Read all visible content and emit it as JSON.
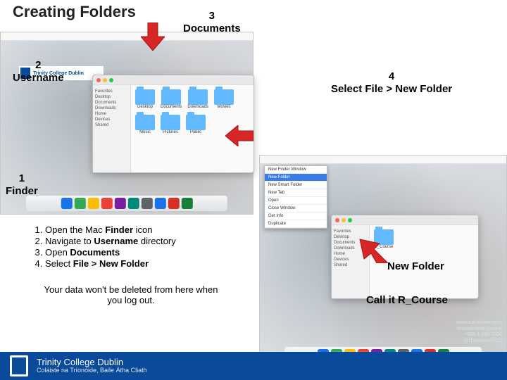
{
  "slide": {
    "title": "Creating Folders"
  },
  "callouts": {
    "c1": {
      "num": "1",
      "label": "Finder"
    },
    "c2": {
      "num": "2",
      "label": "Username"
    },
    "c3": {
      "num": "3",
      "label": "Documents"
    },
    "c4": {
      "num": "4",
      "label": "Select File > New Folder"
    },
    "c5": {
      "label": "New Folder"
    },
    "c6": {
      "label": "Call it R_Course"
    }
  },
  "steps": [
    {
      "pre": "Open the Mac ",
      "b": "Finder",
      "post": " icon"
    },
    {
      "pre": "Navigate to ",
      "b": "Username",
      "post": " directory"
    },
    {
      "pre": "Open ",
      "b": "Documents",
      "post": ""
    },
    {
      "pre": "Select ",
      "b": "File > New Folder",
      "post": ""
    }
  ],
  "note": "Your data won't be deleted from here when you log out.",
  "finder": {
    "sidebar": [
      "Favorites",
      "Desktop",
      "Documents",
      "Downloads",
      "Home",
      "Devices",
      "Shared"
    ],
    "folders_left": [
      "Desktop",
      "Documents",
      "Downloads",
      "Movies",
      "Music",
      "Pictures",
      "Public"
    ],
    "folders_right": [
      "R_Course"
    ]
  },
  "menu": {
    "items": [
      "New Finder Window",
      "New Folder",
      "New Smart Folder",
      "New Tab",
      "Open",
      "Close Window",
      "Get Info",
      "Duplicate"
    ],
    "highlight_index": 1
  },
  "brand": {
    "name": "Trinity College Dublin",
    "ga": "Coláiste na Tríonóide, Baile Átha Cliath"
  },
  "contact": [
    "www.tcd.ie/itservices",
    "itservicedesk@tcd.ie",
    "+353-1-896-2000",
    "@ITServicesTCD"
  ]
}
